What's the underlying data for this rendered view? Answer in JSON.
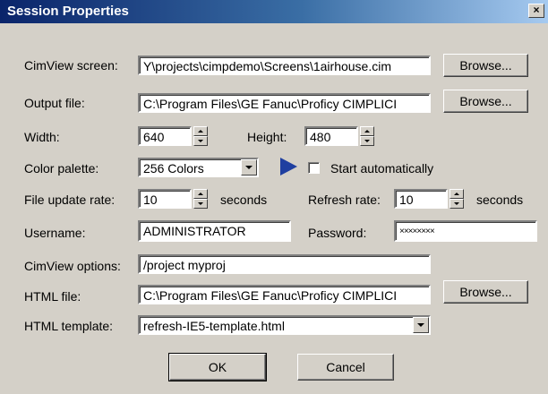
{
  "window": {
    "title": "Session Properties",
    "close_glyph": "×"
  },
  "labels": {
    "cimview_screen": "CimView screen:",
    "output_file": "Output file:",
    "width": "Width:",
    "height": "Height:",
    "color_palette": "Color palette:",
    "start_automatically": "Start automatically",
    "file_update_rate": "File update rate:",
    "seconds_1": "seconds",
    "refresh_rate": "Refresh rate:",
    "seconds_2": "seconds",
    "username": "Username:",
    "password": "Password:",
    "cimview_options": "CimView options:",
    "html_file": "HTML file:",
    "html_template": "HTML template:"
  },
  "fields": {
    "cimview_screen": "Y\\projects\\cimpdemo\\Screens\\1airhouse.cim",
    "output_file": "C:\\Program Files\\GE Fanuc\\Proficy CIMPLICI",
    "width": "640",
    "height": "480",
    "color_palette": "256 Colors",
    "file_update_rate": "10",
    "refresh_rate": "10",
    "username": "ADMINISTRATOR",
    "password": "××××××××",
    "cimview_options": "/project myproj",
    "html_file": "C:\\Program Files\\GE Fanuc\\Proficy CIMPLICI",
    "html_template": "refresh-IE5-template.html"
  },
  "start_automatically_checked": false,
  "buttons": {
    "browse_1": "Browse...",
    "browse_2": "Browse...",
    "browse_3": "Browse...",
    "ok": "OK",
    "cancel": "Cancel"
  },
  "colors": {
    "title_start": "#0a246a",
    "title_end": "#a6caf0",
    "arrow": "#1f3fa0"
  }
}
